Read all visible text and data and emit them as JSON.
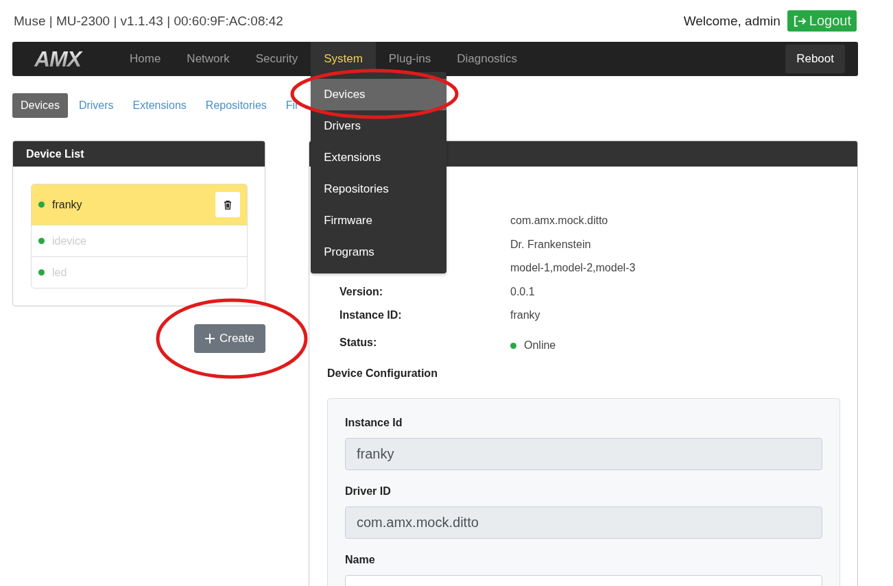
{
  "header": {
    "device_info": "Muse | MU-2300 | v1.1.43 | 00:60:9F:AC:08:42",
    "welcome": "Welcome, admin",
    "logout": "Logout"
  },
  "navbar": {
    "logo": "AMX",
    "items": [
      {
        "label": "Home",
        "selected": false
      },
      {
        "label": "Network",
        "selected": false
      },
      {
        "label": "Security",
        "selected": false
      },
      {
        "label": "System",
        "selected": true,
        "expanded": true
      },
      {
        "label": "Plug-ins",
        "selected": false
      },
      {
        "label": "Diagnostics",
        "selected": false
      }
    ],
    "reboot": "Reboot"
  },
  "system_menu": [
    {
      "label": "Devices",
      "selected": true
    },
    {
      "label": "Drivers",
      "selected": false
    },
    {
      "label": "Extensions",
      "selected": false
    },
    {
      "label": "Repositories",
      "selected": false
    },
    {
      "label": "Firmware",
      "selected": false
    },
    {
      "label": "Programs",
      "selected": false
    }
  ],
  "subtabs": [
    {
      "label": "Devices",
      "selected": true
    },
    {
      "label": "Drivers",
      "selected": false
    },
    {
      "label": "Extensions",
      "selected": false
    },
    {
      "label": "Repositories",
      "selected": false
    },
    {
      "label": "Fir",
      "selected": false
    }
  ],
  "device_list": {
    "title": "Device List",
    "items": [
      {
        "name": "franky",
        "selected": true,
        "online": true
      },
      {
        "name": "idevice",
        "selected": false,
        "online": true
      },
      {
        "name": "led",
        "selected": false,
        "online": true
      }
    ],
    "create": "Create"
  },
  "details": {
    "rows": [
      {
        "value": "com.amx.mock.ditto"
      },
      {
        "value": "Dr. Frankenstein"
      },
      {
        "value": "model-1,model-2,model-3"
      },
      {
        "label": "Version:",
        "value": "0.0.1"
      },
      {
        "label": "Instance ID:",
        "value": "franky"
      },
      {
        "label": "Status:",
        "value": "Online",
        "kind": "status",
        "online": true
      }
    ],
    "config_title": "Device Configuration",
    "fields": [
      {
        "label": "Instance Id",
        "value": "franky",
        "disabled": true
      },
      {
        "label": "Driver ID",
        "value": "com.amx.mock.ditto",
        "disabled": true
      },
      {
        "label": "Name",
        "disabled": false
      }
    ]
  },
  "annotations": [
    {
      "kind": "ellipse"
    },
    {
      "kind": "ellipse"
    }
  ]
}
